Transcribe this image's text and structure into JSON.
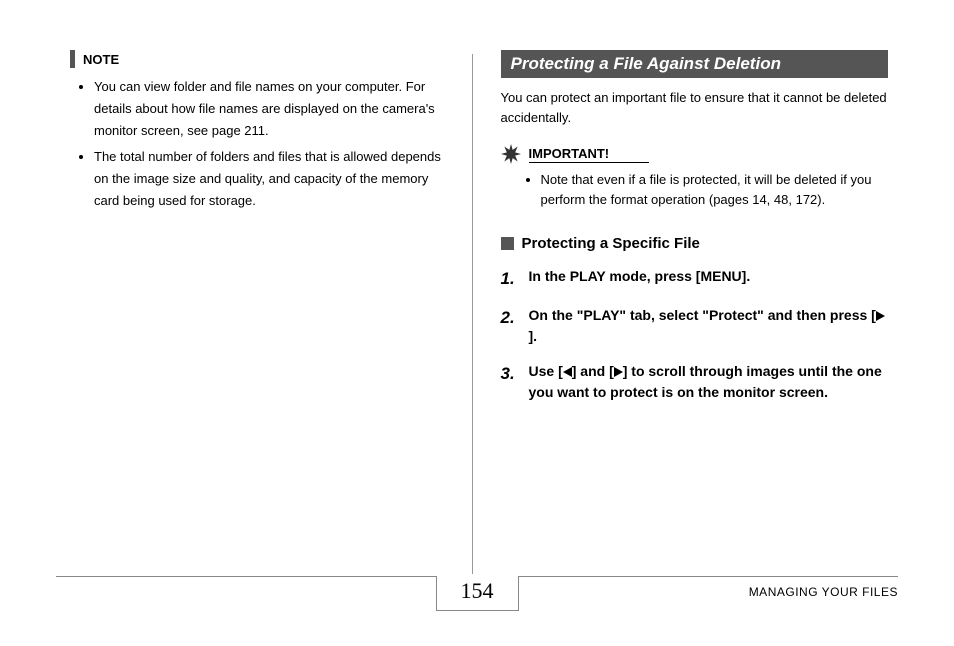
{
  "left": {
    "noteLabel": "NOTE",
    "bullets": [
      "You can view folder and file names on your computer. For details about how file names are displayed on the camera's monitor screen, see page 211.",
      "The total number of folders and files that is allowed depends on the image size and quality, and capacity of the memory card being used for storage."
    ]
  },
  "right": {
    "sectionTitle": "Protecting a File Against Deletion",
    "intro": "You can protect an important file to ensure that it cannot be deleted accidentally.",
    "importantLabel": "IMPORTANT!",
    "importantBullets": [
      "Note that even if a file is protected, it will be deleted if you perform the format operation (pages 14, 48, 172)."
    ],
    "subHeading": "Protecting a Specific File",
    "steps": [
      {
        "num": "1.",
        "pre": "In the PLAY mode, press [MENU].",
        "post": ""
      },
      {
        "num": "2.",
        "pre": "On the \"PLAY\" tab, select \"Protect\" and then press [",
        "arrow": "right",
        "post": "]."
      },
      {
        "num": "3.",
        "pre": "Use [",
        "arrow": "left",
        "mid": "] and [",
        "arrow2": "right",
        "post": "] to scroll through images until the one you want to protect is on the monitor screen."
      }
    ]
  },
  "footer": {
    "page": "154",
    "section": "MANAGING YOUR FILES"
  }
}
